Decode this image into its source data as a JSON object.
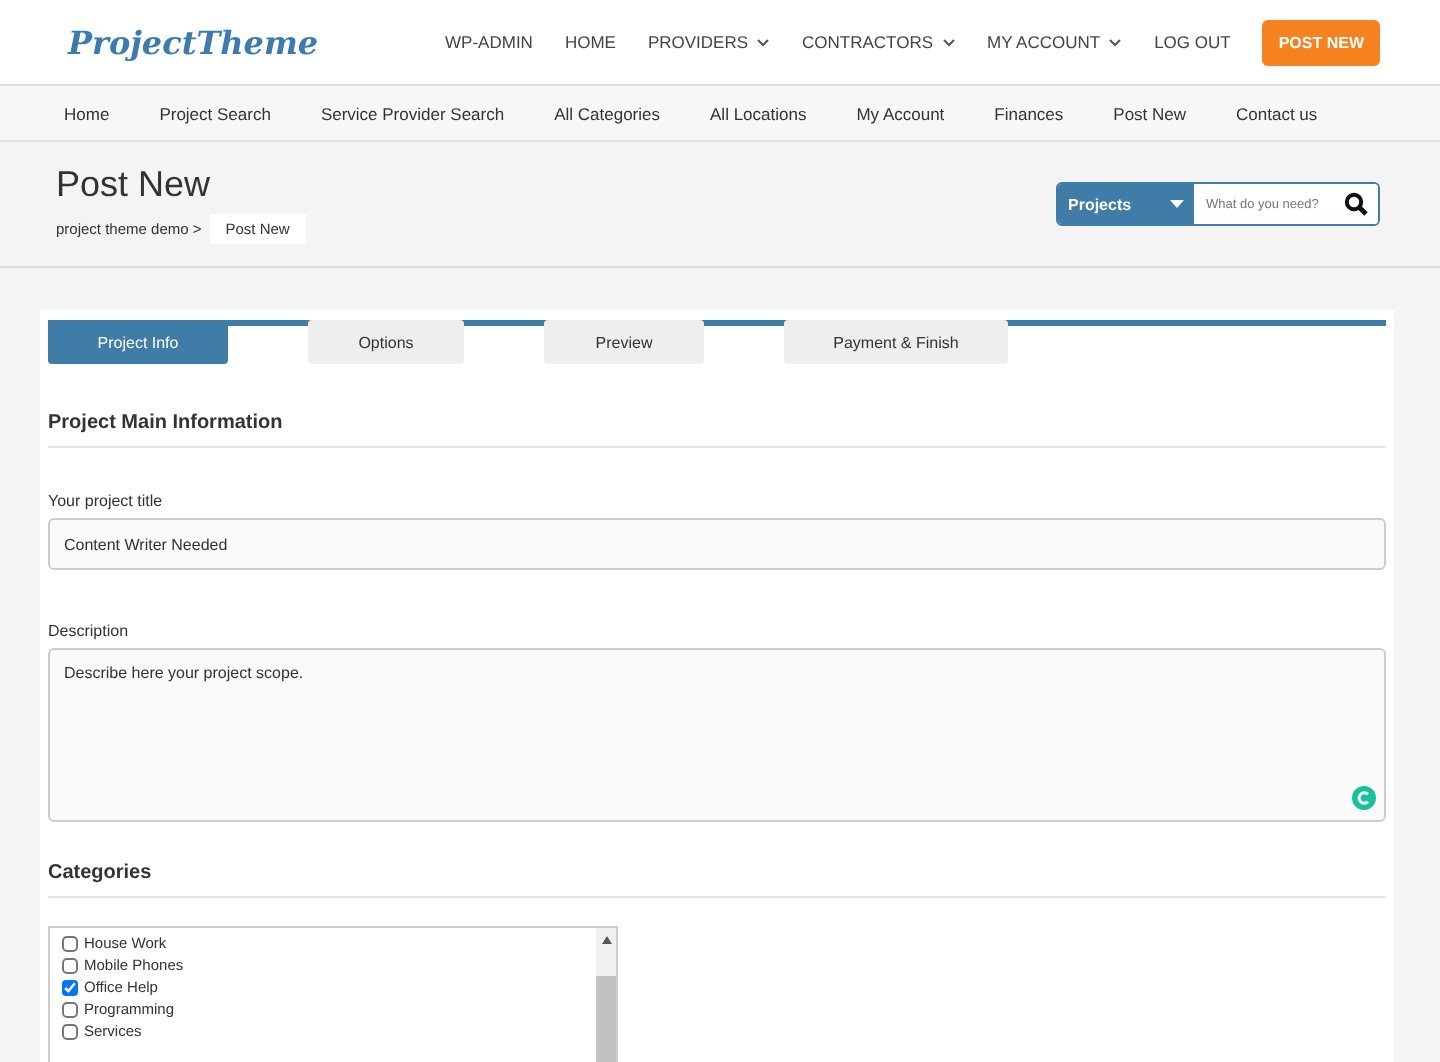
{
  "header": {
    "logo": "ProjectTheme",
    "menu": [
      {
        "label": "WP-ADMIN",
        "dropdown": false
      },
      {
        "label": "HOME",
        "dropdown": false
      },
      {
        "label": "PROVIDERS",
        "dropdown": true
      },
      {
        "label": "CONTRACTORS",
        "dropdown": true
      },
      {
        "label": "MY ACCOUNT",
        "dropdown": true
      },
      {
        "label": "LOG OUT",
        "dropdown": false
      }
    ],
    "cta": "POST NEW"
  },
  "nav": [
    "Home",
    "Project Search",
    "Service Provider Search",
    "All Categories",
    "All Locations",
    "My Account",
    "Finances",
    "Post New",
    "Contact us"
  ],
  "page": {
    "title": "Post New",
    "breadcrumb": [
      "project theme demo >",
      "Post New"
    ]
  },
  "search": {
    "category": "Projects",
    "placeholder": "What do you need?"
  },
  "tabs": [
    {
      "label": "Project Info",
      "selected": true
    },
    {
      "label": "Options",
      "selected": false
    },
    {
      "label": "Preview",
      "selected": false
    },
    {
      "label": "Payment & Finish",
      "selected": false
    }
  ],
  "section_title": "Project Main Information",
  "fields": [
    {
      "label": "Your project title",
      "kind": "input",
      "value": "Content Writer Needed"
    },
    {
      "label": "Description",
      "kind": "textarea",
      "value": "Describe here your project scope."
    }
  ],
  "categories": {
    "title": "Categories",
    "items": [
      {
        "label": "House Work",
        "checked": false
      },
      {
        "label": "Mobile Phones",
        "checked": false
      },
      {
        "label": "Office Help",
        "checked": true
      },
      {
        "label": "Programming",
        "checked": false
      },
      {
        "label": "Services",
        "checked": false
      }
    ]
  }
}
